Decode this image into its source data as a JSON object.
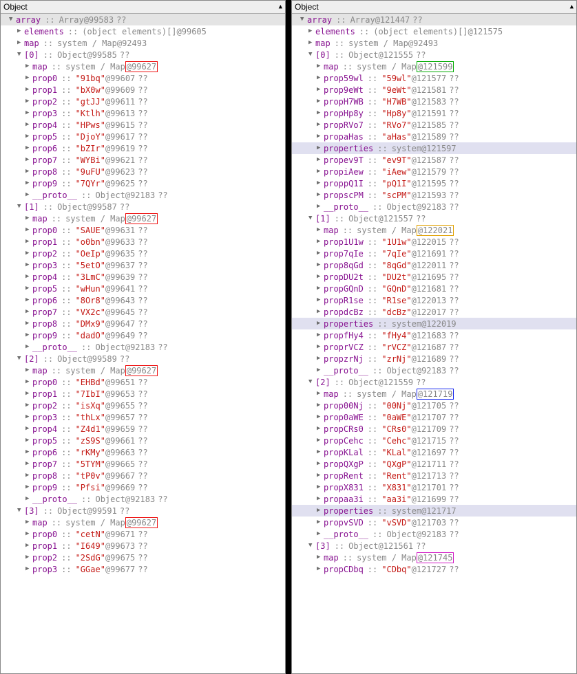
{
  "header_title": "Object",
  "panels": [
    {
      "array_name": "array",
      "array_type": "Array",
      "array_addr": "@99583",
      "tree": [
        {
          "depth": 0,
          "open": true,
          "name": "array",
          "sep": "::",
          "type": "Array",
          "addr": "@99583",
          "qq": "??",
          "arrayrow": true
        },
        {
          "depth": 1,
          "open": false,
          "name": "elements",
          "sep": "::",
          "type": "(object elements)[]",
          "addr": "@99605"
        },
        {
          "depth": 1,
          "open": false,
          "name": "map",
          "sep": "::",
          "type": "system / Map",
          "addr": "@92493"
        },
        {
          "depth": 1,
          "open": true,
          "name": "[0]",
          "sep": "::",
          "type": "Object",
          "addr": "@99585",
          "qq": "??"
        },
        {
          "depth": 2,
          "open": false,
          "name": "map",
          "sep": "::",
          "type": "system / Map",
          "addr": "@99627",
          "box": "red"
        },
        {
          "depth": 2,
          "open": false,
          "name": "prop0",
          "sep": "::",
          "val": "\"91bq\"",
          "addr": "@99607",
          "qq": "??"
        },
        {
          "depth": 2,
          "open": false,
          "name": "prop1",
          "sep": "::",
          "val": "\"bX0w\"",
          "addr": "@99609",
          "qq": "??"
        },
        {
          "depth": 2,
          "open": false,
          "name": "prop2",
          "sep": "::",
          "val": "\"gtJJ\"",
          "addr": "@99611",
          "qq": "??"
        },
        {
          "depth": 2,
          "open": false,
          "name": "prop3",
          "sep": "::",
          "val": "\"Ktlh\"",
          "addr": "@99613",
          "qq": "??"
        },
        {
          "depth": 2,
          "open": false,
          "name": "prop4",
          "sep": "::",
          "val": "\"HPws\"",
          "addr": "@99615",
          "qq": "??"
        },
        {
          "depth": 2,
          "open": false,
          "name": "prop5",
          "sep": "::",
          "val": "\"DjoY\"",
          "addr": "@99617",
          "qq": "??"
        },
        {
          "depth": 2,
          "open": false,
          "name": "prop6",
          "sep": "::",
          "val": "\"bZIr\"",
          "addr": "@99619",
          "qq": "??"
        },
        {
          "depth": 2,
          "open": false,
          "name": "prop7",
          "sep": "::",
          "val": "\"WYBi\"",
          "addr": "@99621",
          "qq": "??"
        },
        {
          "depth": 2,
          "open": false,
          "name": "prop8",
          "sep": "::",
          "val": "\"9uFU\"",
          "addr": "@99623",
          "qq": "??"
        },
        {
          "depth": 2,
          "open": false,
          "name": "prop9",
          "sep": "::",
          "val": "\"7QYr\"",
          "addr": "@99625",
          "qq": "??"
        },
        {
          "depth": 2,
          "open": false,
          "name": "__proto__",
          "sep": "::",
          "type": "Object",
          "addr": "@92183",
          "qq": "??"
        },
        {
          "depth": 1,
          "open": true,
          "name": "[1]",
          "sep": "::",
          "type": "Object",
          "addr": "@99587",
          "qq": "??"
        },
        {
          "depth": 2,
          "open": false,
          "name": "map",
          "sep": "::",
          "type": "system / Map",
          "addr": "@99627",
          "box": "red"
        },
        {
          "depth": 2,
          "open": false,
          "name": "prop0",
          "sep": "::",
          "val": "\"SAUE\"",
          "addr": "@99631",
          "qq": "??"
        },
        {
          "depth": 2,
          "open": false,
          "name": "prop1",
          "sep": "::",
          "val": "\"o0bn\"",
          "addr": "@99633",
          "qq": "??"
        },
        {
          "depth": 2,
          "open": false,
          "name": "prop2",
          "sep": "::",
          "val": "\"OeIp\"",
          "addr": "@99635",
          "qq": "??"
        },
        {
          "depth": 2,
          "open": false,
          "name": "prop3",
          "sep": "::",
          "val": "\"5etO\"",
          "addr": "@99637",
          "qq": "??"
        },
        {
          "depth": 2,
          "open": false,
          "name": "prop4",
          "sep": "::",
          "val": "\"3LmC\"",
          "addr": "@99639",
          "qq": "??"
        },
        {
          "depth": 2,
          "open": false,
          "name": "prop5",
          "sep": "::",
          "val": "\"wHun\"",
          "addr": "@99641",
          "qq": "??"
        },
        {
          "depth": 2,
          "open": false,
          "name": "prop6",
          "sep": "::",
          "val": "\"8Or8\"",
          "addr": "@99643",
          "qq": "??"
        },
        {
          "depth": 2,
          "open": false,
          "name": "prop7",
          "sep": "::",
          "val": "\"VX2c\"",
          "addr": "@99645",
          "qq": "??"
        },
        {
          "depth": 2,
          "open": false,
          "name": "prop8",
          "sep": "::",
          "val": "\"DMx9\"",
          "addr": "@99647",
          "qq": "??"
        },
        {
          "depth": 2,
          "open": false,
          "name": "prop9",
          "sep": "::",
          "val": "\"dadO\"",
          "addr": "@99649",
          "qq": "??"
        },
        {
          "depth": 2,
          "open": false,
          "name": "__proto__",
          "sep": "::",
          "type": "Object",
          "addr": "@92183",
          "qq": "??"
        },
        {
          "depth": 1,
          "open": true,
          "name": "[2]",
          "sep": "::",
          "type": "Object",
          "addr": "@99589",
          "qq": "??"
        },
        {
          "depth": 2,
          "open": false,
          "name": "map",
          "sep": "::",
          "type": "system / Map",
          "addr": "@99627",
          "box": "red"
        },
        {
          "depth": 2,
          "open": false,
          "name": "prop0",
          "sep": "::",
          "val": "\"EHBd\"",
          "addr": "@99651",
          "qq": "??"
        },
        {
          "depth": 2,
          "open": false,
          "name": "prop1",
          "sep": "::",
          "val": "\"7IbI\"",
          "addr": "@99653",
          "qq": "??"
        },
        {
          "depth": 2,
          "open": false,
          "name": "prop2",
          "sep": "::",
          "val": "\"isXq\"",
          "addr": "@99655",
          "qq": "??"
        },
        {
          "depth": 2,
          "open": false,
          "name": "prop3",
          "sep": "::",
          "val": "\"thLx\"",
          "addr": "@99657",
          "qq": "??"
        },
        {
          "depth": 2,
          "open": false,
          "name": "prop4",
          "sep": "::",
          "val": "\"Z4d1\"",
          "addr": "@99659",
          "qq": "??"
        },
        {
          "depth": 2,
          "open": false,
          "name": "prop5",
          "sep": "::",
          "val": "\"zS9S\"",
          "addr": "@99661",
          "qq": "??"
        },
        {
          "depth": 2,
          "open": false,
          "name": "prop6",
          "sep": "::",
          "val": "\"rKMy\"",
          "addr": "@99663",
          "qq": "??"
        },
        {
          "depth": 2,
          "open": false,
          "name": "prop7",
          "sep": "::",
          "val": "\"5TYM\"",
          "addr": "@99665",
          "qq": "??"
        },
        {
          "depth": 2,
          "open": false,
          "name": "prop8",
          "sep": "::",
          "val": "\"tP0v\"",
          "addr": "@99667",
          "qq": "??"
        },
        {
          "depth": 2,
          "open": false,
          "name": "prop9",
          "sep": "::",
          "val": "\"Pfsi\"",
          "addr": "@99669",
          "qq": "??"
        },
        {
          "depth": 2,
          "open": false,
          "name": "__proto__",
          "sep": "::",
          "type": "Object",
          "addr": "@92183",
          "qq": "??"
        },
        {
          "depth": 1,
          "open": true,
          "name": "[3]",
          "sep": "::",
          "type": "Object",
          "addr": "@99591",
          "qq": "??"
        },
        {
          "depth": 2,
          "open": false,
          "name": "map",
          "sep": "::",
          "type": "system / Map",
          "addr": "@99627",
          "box": "red"
        },
        {
          "depth": 2,
          "open": false,
          "name": "prop0",
          "sep": "::",
          "val": "\"cetN\"",
          "addr": "@99671",
          "qq": "??"
        },
        {
          "depth": 2,
          "open": false,
          "name": "prop1",
          "sep": "::",
          "val": "\"I649\"",
          "addr": "@99673",
          "qq": "??"
        },
        {
          "depth": 2,
          "open": false,
          "name": "prop2",
          "sep": "::",
          "val": "\"2SdG\"",
          "addr": "@99675",
          "qq": "??"
        },
        {
          "depth": 2,
          "open": false,
          "name": "prop3",
          "sep": "::",
          "val": "\"GGae\"",
          "addr": "@99677",
          "qq": "??"
        }
      ]
    },
    {
      "array_name": "array",
      "array_type": "Array",
      "array_addr": "@121447",
      "tree": [
        {
          "depth": 0,
          "open": true,
          "name": "array",
          "sep": "::",
          "type": "Array",
          "addr": "@121447",
          "qq": "??",
          "arrayrow": true
        },
        {
          "depth": 1,
          "open": false,
          "name": "elements",
          "sep": "::",
          "type": "(object elements)[]",
          "addr": "@121575"
        },
        {
          "depth": 1,
          "open": false,
          "name": "map",
          "sep": "::",
          "type": "system / Map",
          "addr": "@92493"
        },
        {
          "depth": 1,
          "open": true,
          "name": "[0]",
          "sep": "::",
          "type": "Object",
          "addr": "@121555",
          "qq": "??"
        },
        {
          "depth": 2,
          "open": false,
          "name": "map",
          "sep": "::",
          "type": "system / Map",
          "addr": "@121599",
          "box": "green"
        },
        {
          "depth": 2,
          "open": false,
          "name": "prop59wl",
          "sep": "::",
          "val": "\"59wl\"",
          "addr": "@121577",
          "qq": "??"
        },
        {
          "depth": 2,
          "open": false,
          "name": "prop9eWt",
          "sep": "::",
          "val": "\"9eWt\"",
          "addr": "@121581",
          "qq": "??"
        },
        {
          "depth": 2,
          "open": false,
          "name": "propH7WB",
          "sep": "::",
          "val": "\"H7WB\"",
          "addr": "@121583",
          "qq": "??"
        },
        {
          "depth": 2,
          "open": false,
          "name": "propHp8y",
          "sep": "::",
          "val": "\"Hp8y\"",
          "addr": "@121591",
          "qq": "??"
        },
        {
          "depth": 2,
          "open": false,
          "name": "propRVo7",
          "sep": "::",
          "val": "\"RVo7\"",
          "addr": "@121585",
          "qq": "??"
        },
        {
          "depth": 2,
          "open": false,
          "name": "propaHas",
          "sep": "::",
          "val": "\"aHas\"",
          "addr": "@121589",
          "qq": "??"
        },
        {
          "depth": 2,
          "open": false,
          "name": "properties",
          "sep": "::",
          "type": "system",
          "addr": "@121597",
          "hl": true
        },
        {
          "depth": 2,
          "open": false,
          "name": "propev9T",
          "sep": "::",
          "val": "\"ev9T\"",
          "addr": "@121587",
          "qq": "??"
        },
        {
          "depth": 2,
          "open": false,
          "name": "propiAew",
          "sep": "::",
          "val": "\"iAew\"",
          "addr": "@121579",
          "qq": "??"
        },
        {
          "depth": 2,
          "open": false,
          "name": "proppQ1I",
          "sep": "::",
          "val": "\"pQ1I\"",
          "addr": "@121595",
          "qq": "??"
        },
        {
          "depth": 2,
          "open": false,
          "name": "propscPM",
          "sep": "::",
          "val": "\"scPM\"",
          "addr": "@121593",
          "qq": "??"
        },
        {
          "depth": 2,
          "open": false,
          "name": "__proto__",
          "sep": "::",
          "type": "Object",
          "addr": "@92183",
          "qq": "??"
        },
        {
          "depth": 1,
          "open": true,
          "name": "[1]",
          "sep": "::",
          "type": "Object",
          "addr": "@121557",
          "qq": "??"
        },
        {
          "depth": 2,
          "open": false,
          "name": "map",
          "sep": "::",
          "type": "system / Map",
          "addr": "@122021",
          "box": "yellow"
        },
        {
          "depth": 2,
          "open": false,
          "name": "prop1U1w",
          "sep": "::",
          "val": "\"1U1w\"",
          "addr": "@122015",
          "qq": "??"
        },
        {
          "depth": 2,
          "open": false,
          "name": "prop7qIe",
          "sep": "::",
          "val": "\"7qIe\"",
          "addr": "@121691",
          "qq": "??"
        },
        {
          "depth": 2,
          "open": false,
          "name": "prop8qGd",
          "sep": "::",
          "val": "\"8qGd\"",
          "addr": "@122011",
          "qq": "??"
        },
        {
          "depth": 2,
          "open": false,
          "name": "propDU2t",
          "sep": "::",
          "val": "\"DU2t\"",
          "addr": "@121695",
          "qq": "??"
        },
        {
          "depth": 2,
          "open": false,
          "name": "propGQnD",
          "sep": "::",
          "val": "\"GQnD\"",
          "addr": "@121681",
          "qq": "??"
        },
        {
          "depth": 2,
          "open": false,
          "name": "propR1se",
          "sep": "::",
          "val": "\"R1se\"",
          "addr": "@122013",
          "qq": "??"
        },
        {
          "depth": 2,
          "open": false,
          "name": "propdcBz",
          "sep": "::",
          "val": "\"dcBz\"",
          "addr": "@122017",
          "qq": "??"
        },
        {
          "depth": 2,
          "open": false,
          "name": "properties",
          "sep": "::",
          "type": "system",
          "addr": "@122019",
          "hl": true
        },
        {
          "depth": 2,
          "open": false,
          "name": "propfHy4",
          "sep": "::",
          "val": "\"fHy4\"",
          "addr": "@121683",
          "qq": "??"
        },
        {
          "depth": 2,
          "open": false,
          "name": "proprVCZ",
          "sep": "::",
          "val": "\"rVCZ\"",
          "addr": "@121687",
          "qq": "??"
        },
        {
          "depth": 2,
          "open": false,
          "name": "propzrNj",
          "sep": "::",
          "val": "\"zrNj\"",
          "addr": "@121689",
          "qq": "??"
        },
        {
          "depth": 2,
          "open": false,
          "name": "__proto__",
          "sep": "::",
          "type": "Object",
          "addr": "@92183",
          "qq": "??"
        },
        {
          "depth": 1,
          "open": true,
          "name": "[2]",
          "sep": "::",
          "type": "Object",
          "addr": "@121559",
          "qq": "??"
        },
        {
          "depth": 2,
          "open": false,
          "name": "map",
          "sep": "::",
          "type": "system / Map",
          "addr": "@121719",
          "box": "blue"
        },
        {
          "depth": 2,
          "open": false,
          "name": "prop00Nj",
          "sep": "::",
          "val": "\"00Nj\"",
          "addr": "@121705",
          "qq": "??"
        },
        {
          "depth": 2,
          "open": false,
          "name": "prop0aWE",
          "sep": "::",
          "val": "\"0aWE\"",
          "addr": "@121707",
          "qq": "??"
        },
        {
          "depth": 2,
          "open": false,
          "name": "propCRs0",
          "sep": "::",
          "val": "\"CRs0\"",
          "addr": "@121709",
          "qq": "??"
        },
        {
          "depth": 2,
          "open": false,
          "name": "propCehc",
          "sep": "::",
          "val": "\"Cehc\"",
          "addr": "@121715",
          "qq": "??"
        },
        {
          "depth": 2,
          "open": false,
          "name": "propKLal",
          "sep": "::",
          "val": "\"KLal\"",
          "addr": "@121697",
          "qq": "??"
        },
        {
          "depth": 2,
          "open": false,
          "name": "propQXgP",
          "sep": "::",
          "val": "\"QXgP\"",
          "addr": "@121711",
          "qq": "??"
        },
        {
          "depth": 2,
          "open": false,
          "name": "propRent",
          "sep": "::",
          "val": "\"Rent\"",
          "addr": "@121713",
          "qq": "??"
        },
        {
          "depth": 2,
          "open": false,
          "name": "propX831",
          "sep": "::",
          "val": "\"X831\"",
          "addr": "@121701",
          "qq": "??"
        },
        {
          "depth": 2,
          "open": false,
          "name": "propaa3i",
          "sep": "::",
          "val": "\"aa3i\"",
          "addr": "@121699",
          "qq": "??"
        },
        {
          "depth": 2,
          "open": false,
          "name": "properties",
          "sep": "::",
          "type": "system",
          "addr": "@121717",
          "hl": true
        },
        {
          "depth": 2,
          "open": false,
          "name": "propvSVD",
          "sep": "::",
          "val": "\"vSVD\"",
          "addr": "@121703",
          "qq": "??"
        },
        {
          "depth": 2,
          "open": false,
          "name": "__proto__",
          "sep": "::",
          "type": "Object",
          "addr": "@92183",
          "qq": "??"
        },
        {
          "depth": 1,
          "open": true,
          "name": "[3]",
          "sep": "::",
          "type": "Object",
          "addr": "@121561",
          "qq": "??"
        },
        {
          "depth": 2,
          "open": false,
          "name": "map",
          "sep": "::",
          "type": "system / Map",
          "addr": "@121745",
          "box": "magenta"
        },
        {
          "depth": 2,
          "open": false,
          "name": "propCDbq",
          "sep": "::",
          "val": "\"CDbq\"",
          "addr": "@121727",
          "qq": "??"
        }
      ]
    }
  ]
}
